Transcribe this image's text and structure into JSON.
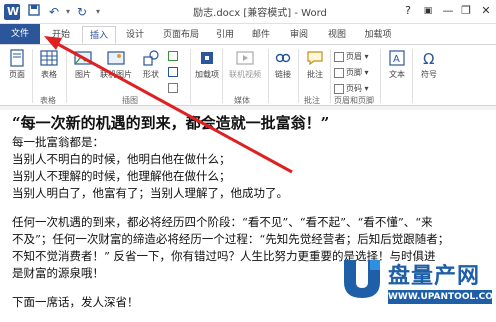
{
  "window": {
    "title": "励志.docx [兼容模式] - Word",
    "help": "?",
    "minimize": "—",
    "restore": "❐",
    "close": "✕"
  },
  "quick_access": {
    "save_icon": "save-icon",
    "undo_icon": "undo-icon",
    "redo_icon": "redo-icon"
  },
  "tabs": {
    "file": "文件",
    "home": "开始",
    "insert": "插入",
    "design": "设计",
    "layout": "页面布局",
    "references": "引用",
    "mailings": "邮件",
    "review": "审阅",
    "view": "视图",
    "addins": "加载项"
  },
  "ribbon": {
    "page": "页面",
    "table": "表格",
    "picture": "图片",
    "online_picture": "联机图片",
    "shapes": "形状",
    "addins": "加载项",
    "online_video": "联机视频",
    "link": "链接",
    "comment": "批注",
    "header": "页眉",
    "footer": "页脚",
    "page_number": "页码",
    "textbox": "文本",
    "symbol": "符号",
    "groups": {
      "tables": "表格",
      "illustrations": "插图",
      "media": "媒体",
      "comments": "批注",
      "header_footer": "页眉和页脚"
    }
  },
  "document": {
    "title": "“每一次新的机遇的到来，都会造就一批富翁！”",
    "lines": [
      "每一批富翁都是：",
      "当别人不明白的时候，他明白他在做什么；",
      "当别人不理解的时候，他理解他在做什么；",
      "当别人明白了，他富有了；当别人理解了，他成功了。"
    ],
    "para2": [
      "任何一次机遇的到来，都必将经历四个阶段：“看不见”、“看不起”、“看不懂”、“来",
      "不及”；任何一次财富的缔造必将经历一个过程：“先知先觉经营者；后知后觉跟随者；",
      "不知不觉消费者！” 反省一下，你有错过吗？人生比努力更重要的是选择！与时俱进",
      "是财富的源泉哦！"
    ],
    "para3": [
      "下面一席话，发人深省！"
    ]
  },
  "watermark": {
    "name": "盘量产网",
    "url": "WWW.UPANTOOL.COM"
  },
  "colors": {
    "accent": "#2b579a",
    "arrow": "#e02020"
  }
}
